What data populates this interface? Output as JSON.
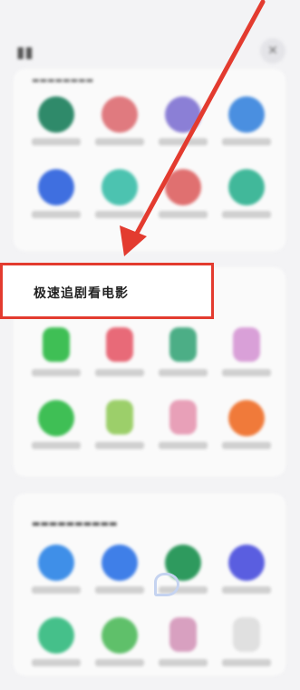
{
  "highlight": {
    "text": "极速追剧看电影"
  },
  "colors": {
    "annotation_red": "#e33b2f"
  }
}
